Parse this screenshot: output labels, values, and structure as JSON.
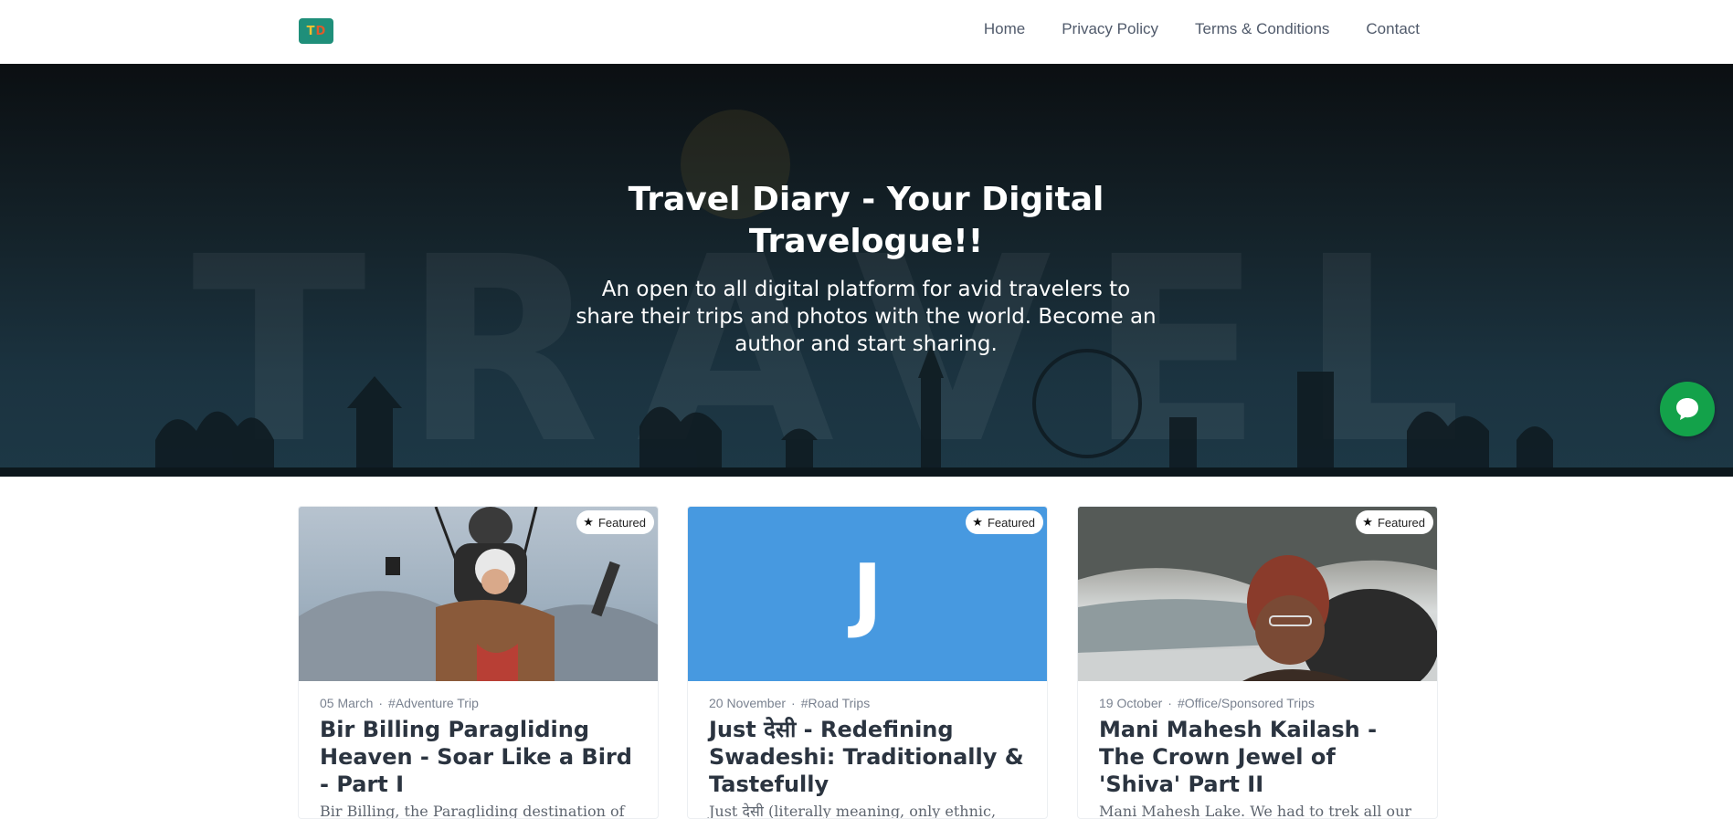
{
  "header": {
    "logo_text": "TD",
    "nav": [
      "Home",
      "Privacy Policy",
      "Terms & Conditions",
      "Contact"
    ]
  },
  "hero": {
    "title": "Travel Diary - Your Digital Travelogue!!",
    "subtitle": "An open to all digital platform for avid travelers to share their trips and photos with the world. Become an author and start sharing.",
    "background_word": "TRAVEL"
  },
  "chat": {
    "icon": "chat-bubble-icon",
    "color": "#13a24a"
  },
  "posts": [
    {
      "featured": "Featured",
      "date": "05 March",
      "category": "#Adventure Trip",
      "title": "Bir Billing Paragliding Heaven - Soar Like a Bird - Part I",
      "excerpt": "Bir Billing, the Paragliding destination of"
    },
    {
      "featured": "Featured",
      "date": "20 November",
      "category": "#Road Trips",
      "title": "Just देसी - Redefining Swadeshi: Traditionally & Tastefully",
      "excerpt": "Just देसी (literally meaning, only ethnic,",
      "image_letter": "J"
    },
    {
      "featured": "Featured",
      "date": "19 October",
      "category": "#Office/Sponsored Trips",
      "title": "Mani Mahesh Kailash - The Crown Jewel of 'Shiva' Part II",
      "excerpt": "Mani Mahesh Lake. We had to trek all our way to Mani Mahesh Lake via Gauri Kund"
    }
  ],
  "colors": {
    "accent_blue": "#4799e0",
    "hero_dark": "#142229",
    "text_dark": "#2b3440"
  }
}
